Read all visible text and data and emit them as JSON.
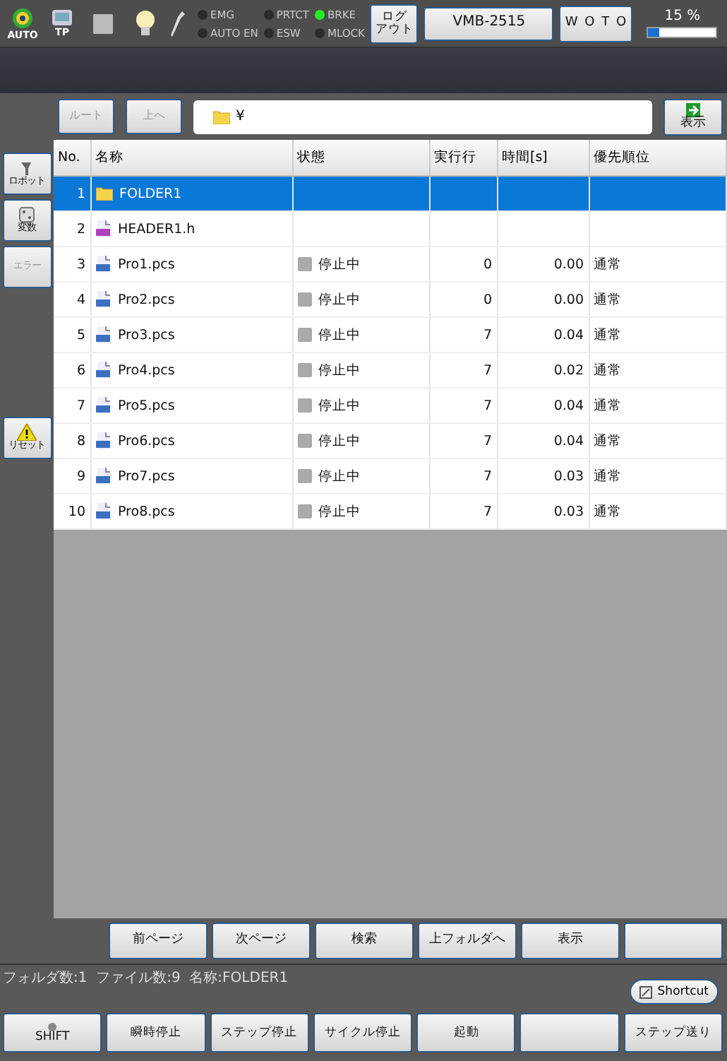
{
  "top_bar": {
    "mode_icons": [
      {
        "kind": "auto",
        "label": "AUTO"
      },
      {
        "kind": "tp",
        "label": "TP"
      }
    ],
    "lamps": [
      {
        "label": "EMG",
        "on": false
      },
      {
        "label": "AUTO EN",
        "on": false
      },
      {
        "label": "PRTCT",
        "on": false
      },
      {
        "label": "ESW",
        "on": false
      },
      {
        "label": "BRKE",
        "on": true
      },
      {
        "label": "MLOCK",
        "on": false
      }
    ],
    "logout_button": {
      "lines": [
        "ログ",
        "アウト"
      ]
    },
    "robot_button": "VMB-2515",
    "user_button": "W O T O",
    "progress": {
      "reading": "15 %",
      "level": 0.15
    }
  },
  "nav": {
    "buttons": [
      {
        "label": "ルート",
        "disabled": true
      },
      {
        "label": "上へ",
        "disabled": true
      }
    ],
    "path": "¥",
    "show_button": "表示"
  },
  "sidebar": [
    {
      "kind": "robot",
      "label": "ロボット",
      "disabled": false
    },
    {
      "kind": "variable",
      "label": "変数",
      "disabled": false
    },
    {
      "kind": "error",
      "label": "エラー",
      "disabled": true
    },
    {
      "kind": "reset",
      "label": "リセット",
      "disabled": false
    }
  ],
  "table": {
    "columns": [
      "No.",
      "名称",
      "状態",
      "実行行",
      "時間[s]",
      "優先順位"
    ],
    "rows": [
      {
        "no": "1",
        "kind": "folder",
        "name": "FOLDER1",
        "selected": true
      },
      {
        "no": "2",
        "kind": "header",
        "name": "HEADER1.h",
        "selected": false
      },
      {
        "no": "3",
        "kind": "program",
        "name": "Pro1.pcs",
        "status": "停止中",
        "line": "0",
        "time": "0.00",
        "priority": "通常",
        "selected": false
      },
      {
        "no": "4",
        "kind": "program",
        "name": "Pro2.pcs",
        "status": "停止中",
        "line": "0",
        "time": "0.00",
        "priority": "通常",
        "selected": false
      },
      {
        "no": "5",
        "kind": "program",
        "name": "Pro3.pcs",
        "status": "停止中",
        "line": "7",
        "time": "0.04",
        "priority": "通常",
        "selected": false
      },
      {
        "no": "6",
        "kind": "program",
        "name": "Pro4.pcs",
        "status": "停止中",
        "line": "7",
        "time": "0.02",
        "priority": "通常",
        "selected": false
      },
      {
        "no": "7",
        "kind": "program",
        "name": "Pro5.pcs",
        "status": "停止中",
        "line": "7",
        "time": "0.04",
        "priority": "通常",
        "selected": false
      },
      {
        "no": "8",
        "kind": "program",
        "name": "Pro6.pcs",
        "status": "停止中",
        "line": "7",
        "time": "0.04",
        "priority": "通常",
        "selected": false
      },
      {
        "no": "9",
        "kind": "program",
        "name": "Pro7.pcs",
        "status": "停止中",
        "line": "7",
        "time": "0.03",
        "priority": "通常",
        "selected": false
      },
      {
        "no": "10",
        "kind": "program",
        "name": "Pro8.pcs",
        "status": "停止中",
        "line": "7",
        "time": "0.03",
        "priority": "通常",
        "selected": false
      }
    ]
  },
  "page_buttons": [
    {
      "kind": "text",
      "label": "前ページ"
    },
    {
      "kind": "text",
      "label": "次ページ"
    },
    {
      "kind": "text",
      "label": "検索"
    },
    {
      "kind": "text",
      "label": "上フォルダへ"
    },
    {
      "kind": "text",
      "label": "表示"
    },
    {
      "kind": "blank"
    }
  ],
  "status_bar": {
    "text": "フォルダ数:1  ファイル数:9  名称:FOLDER1",
    "shortcut_button": "Shortcut"
  },
  "bottom_buttons": [
    {
      "kind": "shift",
      "label": "SHIFT"
    },
    {
      "kind": "plain",
      "label": "瞬時停止"
    },
    {
      "kind": "plain",
      "label": "ステップ停止"
    },
    {
      "kind": "plain",
      "label": "サイクル停止"
    },
    {
      "kind": "plain",
      "label": "起動"
    },
    {
      "kind": "plain"
    },
    {
      "kind": "plain",
      "label": "ステップ送り"
    }
  ]
}
